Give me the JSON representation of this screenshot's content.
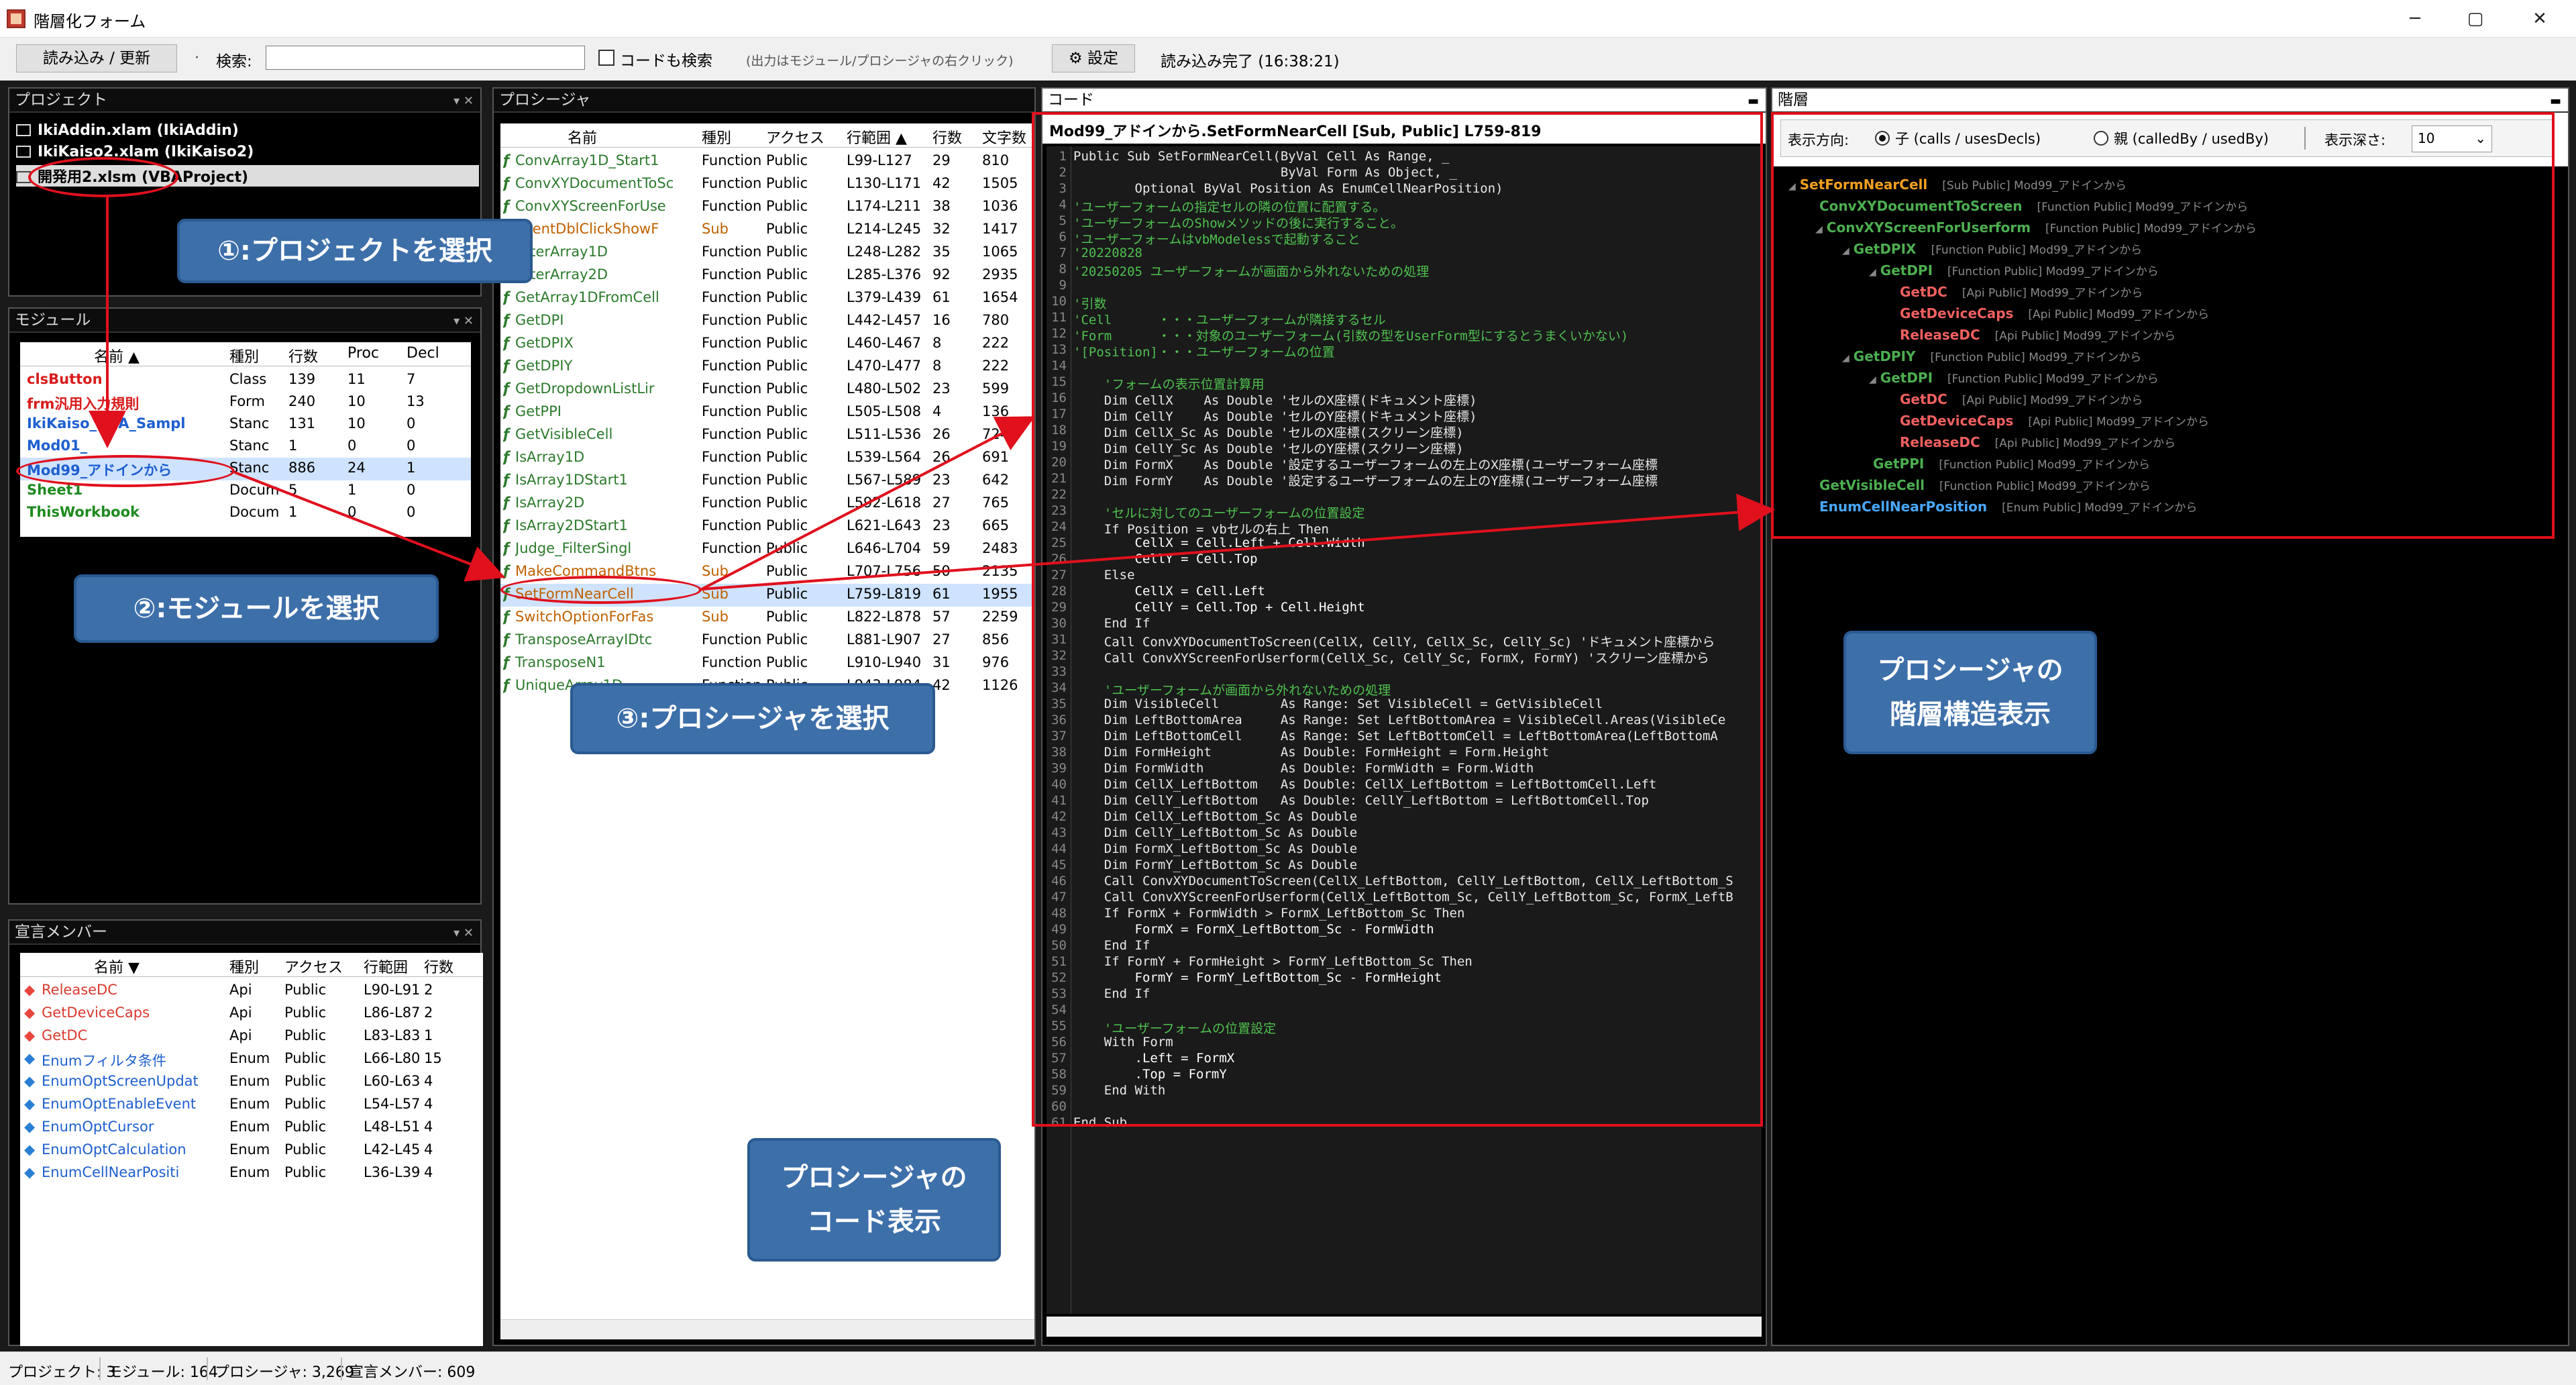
{
  "window": {
    "title": "階層化フォーム",
    "minimize": "─",
    "maximize": "▢",
    "close": "✕"
  },
  "toolbar": {
    "reload": "読み込み / 更新",
    "search_label": "検索:",
    "search_value": "",
    "code_search_label": "コードも検索",
    "hint": "(出力はモジュール/プロシージャの右クリック)",
    "settings": "設定",
    "status": "読み込み完了 (16:38:21)"
  },
  "project": {
    "header": "プロジェクト",
    "items": [
      {
        "label": "IkiAddin.xlam (IkiAddin)"
      },
      {
        "label": "IkiKaiso2.xlam (IkiKaiso2)"
      },
      {
        "label": "開発用2.xlsm (VBAProject)"
      }
    ]
  },
  "module": {
    "header": "モジュール",
    "cols": [
      "名前 ▲",
      "種別",
      "行数",
      "Proc",
      "Decl"
    ],
    "rows": [
      [
        "clsButton",
        "Class",
        "139",
        "11",
        "7"
      ],
      [
        "frm汎用入力規則",
        "Form",
        "240",
        "10",
        "13"
      ],
      [
        "IkiKaiso_VBA_Sampl",
        "Stanc",
        "131",
        "10",
        "0"
      ],
      [
        "Mod01_",
        "Stanc",
        "1",
        "0",
        "0"
      ],
      [
        "Mod99_アドインから",
        "Stanc",
        "886",
        "24",
        "1"
      ],
      [
        "Sheet1",
        "Docum",
        "5",
        "1",
        "0"
      ],
      [
        "ThisWorkbook",
        "Docum",
        "1",
        "0",
        "0"
      ]
    ]
  },
  "declare": {
    "header": "宣言メンバー",
    "cols": [
      "名前 ▼",
      "種別",
      "アクセス",
      "行範囲",
      "行数"
    ],
    "rows": [
      [
        "ReleaseDC",
        "Api",
        "Public",
        "L90-L91",
        "2"
      ],
      [
        "GetDeviceCaps",
        "Api",
        "Public",
        "L86-L87",
        "2"
      ],
      [
        "GetDC",
        "Api",
        "Public",
        "L83-L83",
        "1"
      ],
      [
        "Enumフィルタ条件",
        "Enum",
        "Public",
        "L66-L80",
        "15"
      ],
      [
        "EnumOptScreenUpdat",
        "Enum",
        "Public",
        "L60-L63",
        "4"
      ],
      [
        "EnumOptEnableEvent",
        "Enum",
        "Public",
        "L54-L57",
        "4"
      ],
      [
        "EnumOptCursor",
        "Enum",
        "Public",
        "L48-L51",
        "4"
      ],
      [
        "EnumOptCalculation",
        "Enum",
        "Public",
        "L42-L45",
        "4"
      ],
      [
        "EnumCellNearPositi",
        "Enum",
        "Public",
        "L36-L39",
        "4"
      ]
    ]
  },
  "procedure": {
    "header": "プロシージャ",
    "cols": [
      "名前",
      "種別",
      "アクセス",
      "行範囲 ▲",
      "行数",
      "文字数"
    ],
    "rows": [
      [
        "ConvArray1D_Start1",
        "Function",
        "Public",
        "L99-L127",
        "29",
        "810"
      ],
      [
        "ConvXYDocumentToSc",
        "Function",
        "Public",
        "L130-L171",
        "42",
        "1505"
      ],
      [
        "ConvXYScreenForUse",
        "Function",
        "Public",
        "L174-L211",
        "38",
        "1036"
      ],
      [
        "EventDblClickShowF",
        "Sub",
        "Public",
        "L214-L245",
        "32",
        "1417"
      ],
      [
        "FilterArray1D",
        "Function",
        "Public",
        "L248-L282",
        "35",
        "1065"
      ],
      [
        "FilterArray2D",
        "Function",
        "Public",
        "L285-L376",
        "92",
        "2935"
      ],
      [
        "GetArray1DFromCell",
        "Function",
        "Public",
        "L379-L439",
        "61",
        "1654"
      ],
      [
        "GetDPI",
        "Function",
        "Public",
        "L442-L457",
        "16",
        "780"
      ],
      [
        "GetDPIX",
        "Function",
        "Public",
        "L460-L467",
        "8",
        "222"
      ],
      [
        "GetDPIY",
        "Function",
        "Public",
        "L470-L477",
        "8",
        "222"
      ],
      [
        "GetDropdownListLir",
        "Function",
        "Public",
        "L480-L502",
        "23",
        "599"
      ],
      [
        "GetPPI",
        "Function",
        "Public",
        "L505-L508",
        "4",
        "136"
      ],
      [
        "GetVisibleCell",
        "Function",
        "Public",
        "L511-L536",
        "26",
        "724"
      ],
      [
        "IsArray1D",
        "Function",
        "Public",
        "L539-L564",
        "26",
        "691"
      ],
      [
        "IsArray1DStart1",
        "Function",
        "Public",
        "L567-L589",
        "23",
        "642"
      ],
      [
        "IsArray2D",
        "Function",
        "Public",
        "L592-L618",
        "27",
        "765"
      ],
      [
        "IsArray2DStart1",
        "Function",
        "Public",
        "L621-L643",
        "23",
        "665"
      ],
      [
        "Judge_FilterSingl",
        "Function",
        "Public",
        "L646-L704",
        "59",
        "2483"
      ],
      [
        "MakeCommandBtns",
        "Sub",
        "Public",
        "L707-L756",
        "50",
        "2135"
      ],
      [
        "SetFormNearCell",
        "Sub",
        "Public",
        "L759-L819",
        "61",
        "1955"
      ],
      [
        "SwitchOptionForFas",
        "Sub",
        "Public",
        "L822-L878",
        "57",
        "2259"
      ],
      [
        "TransposeArrayIDtc",
        "Function",
        "Public",
        "L881-L907",
        "27",
        "856"
      ],
      [
        "TransposeN1",
        "Function",
        "Public",
        "L910-L940",
        "31",
        "976"
      ],
      [
        "UniqueArray1D",
        "Function",
        "Public",
        "L943-L984",
        "42",
        "1126"
      ]
    ]
  },
  "code": {
    "header": "コード",
    "title": "Mod99_アドインから.SetFormNearCell  [Sub, Public]  L759-819",
    "lines": [
      "Public Sub SetFormNearCell(ByVal Cell As Range, _",
      "                           ByVal Form As Object, _",
      "        Optional ByVal Position As EnumCellNearPosition)",
      "'ユーザーフォームの指定セルの隣の位置に配置する。",
      "'ユーザーフォームのShowメソッドの後に実行すること。",
      "'ユーザーフォームはvbModelessで起動すること",
      "'20220828",
      "'20250205 ユーザーフォームが画面から外れないための処理",
      "",
      "'引数",
      "'Cell      ・・・ユーザーフォームが隣接するセル",
      "'Form      ・・・対象のユーザーフォーム(引数の型をUserForm型にするとうまくいかない)",
      "'[Position]・・・ユーザーフォームの位置",
      "",
      "    'フォームの表示位置計算用",
      "    Dim CellX    As Double 'セルのX座標(ドキュメント座標)",
      "    Dim CellY    As Double 'セルのY座標(ドキュメント座標)",
      "    Dim CellX_Sc As Double 'セルのX座標(スクリーン座標)",
      "    Dim CellY_Sc As Double 'セルのY座標(スクリーン座標)",
      "    Dim FormX    As Double '設定するユーザーフォームの左上のX座標(ユーザーフォーム座標",
      "    Dim FormY    As Double '設定するユーザーフォームの左上のY座標(ユーザーフォーム座標",
      "",
      "    'セルに対してのユーザーフォームの位置設定",
      "    If Position = vbセルの右上 Then",
      "        CellX = Cell.Left + Cell.Width",
      "        CellY = Cell.Top",
      "    Else",
      "        CellX = Cell.Left",
      "        CellY = Cell.Top + Cell.Height",
      "    End If",
      "    Call ConvXYDocumentToScreen(CellX, CellY, CellX_Sc, CellY_Sc) 'ドキュメント座標から",
      "    Call ConvXYScreenForUserform(CellX_Sc, CellY_Sc, FormX, FormY) 'スクリーン座標から",
      "",
      "    'ユーザーフォームが画面から外れないための処理",
      "    Dim VisibleCell        As Range: Set VisibleCell = GetVisibleCell",
      "    Dim LeftBottomArea     As Range: Set LeftBottomArea = VisibleCell.Areas(VisibleCe",
      "    Dim LeftBottomCell     As Range: Set LeftBottomCell = LeftBottomArea(LeftBottomA",
      "    Dim FormHeight         As Double: FormHeight = Form.Height",
      "    Dim FormWidth          As Double: FormWidth = Form.Width",
      "    Dim CellX_LeftBottom   As Double: CellX_LeftBottom = LeftBottomCell.Left",
      "    Dim CellY_LeftBottom   As Double: CellY_LeftBottom = LeftBottomCell.Top",
      "    Dim CellX_LeftBottom_Sc As Double",
      "    Dim CellY_LeftBottom_Sc As Double",
      "    Dim FormX_LeftBottom_Sc As Double",
      "    Dim FormY_LeftBottom_Sc As Double",
      "    Call ConvXYDocumentToScreen(CellX_LeftBottom, CellY_LeftBottom, CellX_LeftBottom_S",
      "    Call ConvXYScreenForUserform(CellX_LeftBottom_Sc, CellY_LeftBottom_Sc, FormX_LeftB",
      "    If FormX + FormWidth > FormX_LeftBottom_Sc Then",
      "        FormX = FormX_LeftBottom_Sc - FormWidth",
      "    End If",
      "    If FormY + FormHeight > FormY_LeftBottom_Sc Then",
      "        FormY = FormY_LeftBottom_Sc - FormHeight",
      "    End If",
      "",
      "    'ユーザーフォームの位置設定",
      "    With Form",
      "        .Left = FormX",
      "        .Top = FormY",
      "    End With",
      "",
      "End Sub"
    ]
  },
  "hierarchy": {
    "header": "階層",
    "direction_label": "表示方向:",
    "child_label": "子 (calls / usesDecls)",
    "parent_label": "親 (calledBy / usedBy)",
    "depth_label": "表示深さ:",
    "depth_value": "10",
    "nodes": [
      {
        "name": "SetFormNearCell",
        "meta": "[Sub Public]  Mod99_アドインから",
        "color": "#f0a020"
      },
      {
        "name": "ConvXYDocumentToScreen",
        "meta": "[Function Public]  Mod99_アドインから",
        "color": "#4caf50"
      },
      {
        "name": "ConvXYScreenForUserform",
        "meta": "[Function Public]  Mod99_アドインから",
        "color": "#4caf50"
      },
      {
        "name": "GetDPIX",
        "meta": "[Function Public]  Mod99_アドインから",
        "color": "#4caf50"
      },
      {
        "name": "GetDPI",
        "meta": "[Function Public]  Mod99_アドインから",
        "color": "#4caf50"
      },
      {
        "name": "GetDC",
        "meta": "[Api Public]  Mod99_アドインから",
        "color": "#f06060"
      },
      {
        "name": "GetDeviceCaps",
        "meta": "[Api Public]  Mod99_アドインから",
        "color": "#f06060"
      },
      {
        "name": "ReleaseDC",
        "meta": "[Api Public]  Mod99_アドインから",
        "color": "#f06060"
      },
      {
        "name": "GetDPIY",
        "meta": "[Function Public]  Mod99_アドインから",
        "color": "#4caf50"
      },
      {
        "name": "GetDPI",
        "meta": "[Function Public]  Mod99_アドインから",
        "color": "#4caf50"
      },
      {
        "name": "GetDC",
        "meta": "[Api Public]  Mod99_アドインから",
        "color": "#f06060"
      },
      {
        "name": "GetDeviceCaps",
        "meta": "[Api Public]  Mod99_アドインから",
        "color": "#f06060"
      },
      {
        "name": "ReleaseDC",
        "meta": "[Api Public]  Mod99_アドインから",
        "color": "#f06060"
      },
      {
        "name": "GetPPI",
        "meta": "[Function Public]  Mod99_アドインから",
        "color": "#4caf50"
      },
      {
        "name": "GetVisibleCell",
        "meta": "[Function Public]  Mod99_アドインから",
        "color": "#4caf50"
      },
      {
        "name": "EnumCellNearPosition",
        "meta": "[Enum Public]  Mod99_アドインから",
        "color": "#4aa8ff"
      }
    ]
  },
  "callouts": {
    "c1": "①:プロジェクトを選択",
    "c2": "②:モジュールを選択",
    "c3": "③:プロシージャを選択",
    "c4a": "プロシージャの",
    "c4b": "コード表示",
    "c5a": "プロシージャの",
    "c5b": "階層構造表示"
  },
  "status": {
    "projects": "プロジェクト: 3",
    "modules": "モジュール: 164",
    "procedures": "プロシージャ: 3,269",
    "members": "宣言メンバー: 609"
  }
}
